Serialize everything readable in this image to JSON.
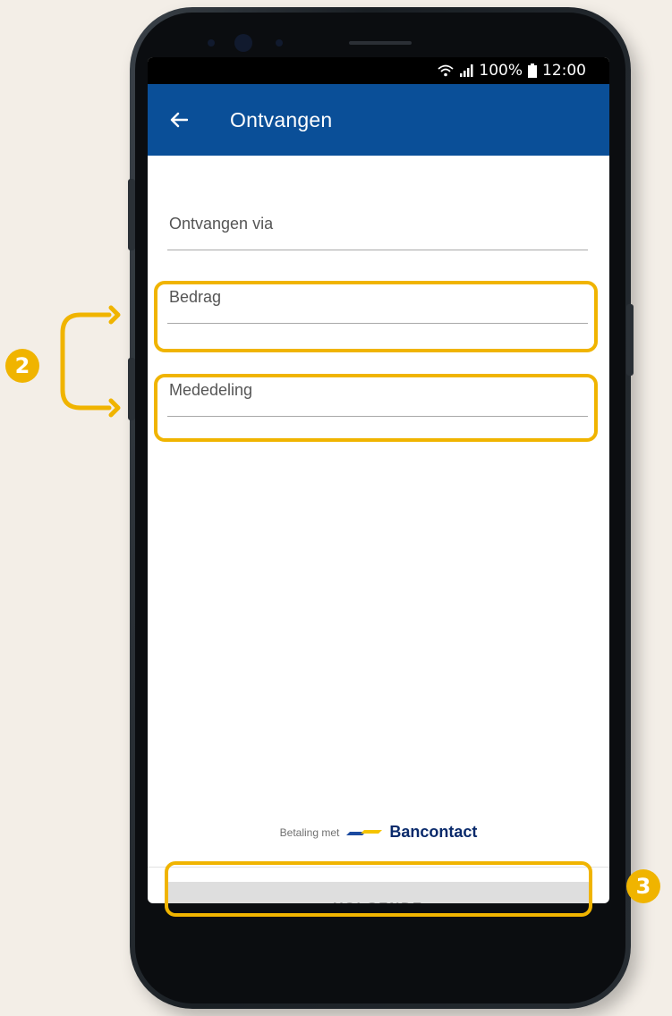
{
  "status_bar": {
    "icons": [
      "wifi-icon",
      "signal-icon"
    ],
    "battery_text": "100%",
    "time": "12:00"
  },
  "app_bar": {
    "back_icon": "back-arrow-icon",
    "title": "Ontvangen"
  },
  "form": {
    "receive_via_label": "Ontvangen via",
    "amount_label": "Bedrag",
    "message_label": "Mededeling"
  },
  "footer": {
    "payment_prefix": "Betaling met",
    "brand_name": "Bancontact",
    "next_button": "VOLGENDE"
  },
  "annotations": {
    "badge_fields": "2",
    "badge_button": "3",
    "highlight_color": "#f0b400"
  },
  "colors": {
    "app_bar": "#0a4f98",
    "button_disabled": "#dedede"
  }
}
